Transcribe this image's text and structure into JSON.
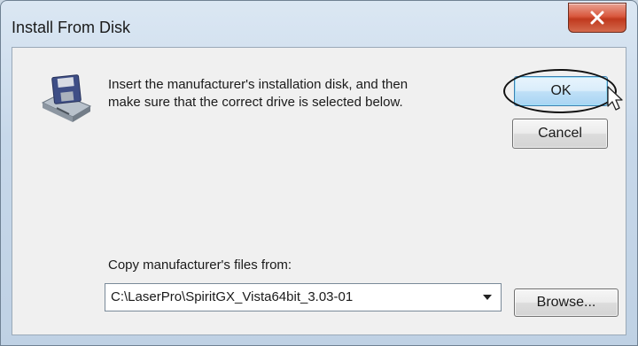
{
  "window": {
    "title": "Install From Disk",
    "close_symbol": "x"
  },
  "message": {
    "line1": "Insert the manufacturer's installation disk, and then",
    "line2": "make sure that the correct drive is selected below."
  },
  "buttons": {
    "ok": "OK",
    "cancel": "Cancel",
    "browse": "Browse..."
  },
  "copy_from": {
    "label": "Copy manufacturer's files from:",
    "value": "C:\\LaserPro\\SpiritGX_Vista64bit_3.03-01"
  },
  "icons": {
    "disk": "floppy-disk-drive-icon",
    "close": "close-icon",
    "dropdown": "chevron-down-icon",
    "cursor": "mouse-cursor-icon"
  },
  "colors": {
    "close_button": "#c0391e",
    "ok_button_border": "#3c7fb1",
    "highlight_ellipse": "#111111"
  }
}
